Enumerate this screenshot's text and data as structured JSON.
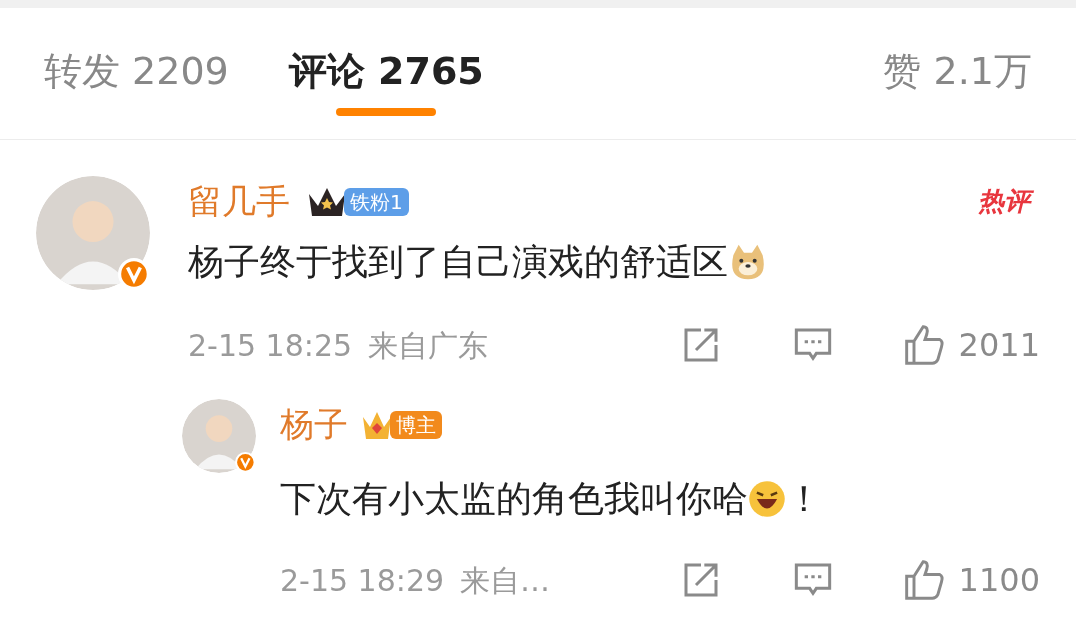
{
  "tabs": [
    {
      "label": "转发 2209",
      "selected": false
    },
    {
      "label": "评论 2765",
      "selected": true
    },
    {
      "label": "赞 2.1万",
      "selected": false
    }
  ],
  "comments": [
    {
      "author": "留几手",
      "badge": {
        "kind": "fan",
        "text": "铁粉1"
      },
      "hot_label": "热评",
      "text": "杨子终于找到了自己演戏的舒适区",
      "emoji": {
        "kind": "dog"
      },
      "time": "2-15 18:25",
      "location": "来自广东",
      "likes": "2011",
      "replies": [
        {
          "author": "杨子",
          "badge": {
            "kind": "host",
            "text": "博主"
          },
          "text": "下次有小太监的角色我叫你哈",
          "emoji": {
            "kind": "laugh"
          },
          "suffix": "！",
          "time": "2-15 18:29",
          "location": "来自…",
          "likes": "1100"
        }
      ]
    }
  ]
}
